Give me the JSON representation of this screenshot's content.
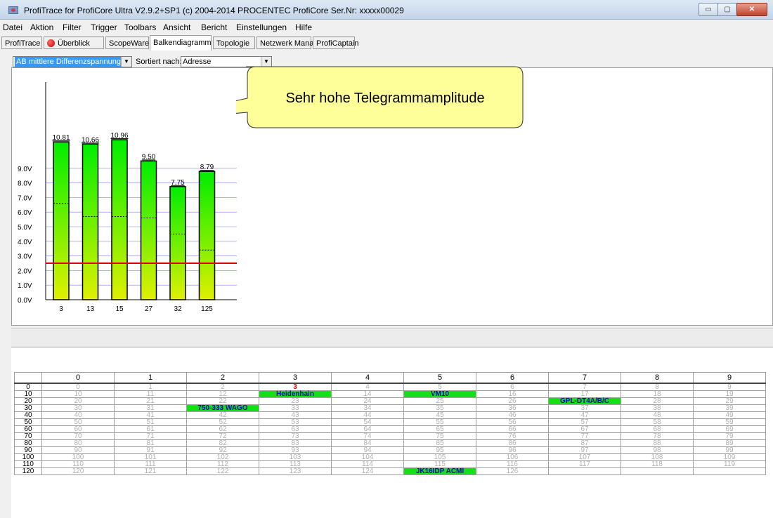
{
  "window": {
    "title": "ProfiTrace for ProfiCore Ultra V2.9.2+SP1 (c) 2004-2014 PROCENTEC  ProfiCore Ser.Nr: xxxxx00029",
    "minimize": "▭",
    "maximize": "▢",
    "close": "✕"
  },
  "menu": [
    "Datei",
    "Aktion",
    "Filter",
    "Trigger",
    "Toolbars",
    "Ansicht",
    "Bericht",
    "Einstellungen",
    "Hilfe"
  ],
  "tabs": [
    "ProfiTrace",
    "Überblick",
    "ScopeWare",
    "Balkendiagramm",
    "Topologie",
    "Netzwerk Manager",
    "ProfiCaptain"
  ],
  "toolbar": {
    "measure_value": "AB mittlere Differenzspannung",
    "sort_label": "Sortiert nach:",
    "sort_value": "Adresse"
  },
  "callout": {
    "text": "Sehr hohe Telegrammamplitude"
  },
  "chart_data": {
    "type": "bar",
    "categories": [
      "3",
      "13",
      "15",
      "27",
      "32",
      "125"
    ],
    "values": [
      10.81,
      10.66,
      10.96,
      9.5,
      7.75,
      8.79
    ],
    "value_labels": [
      "10.81",
      "10.66",
      "10.96",
      "9.50",
      "7.75",
      "8.79"
    ],
    "secondary_markers": [
      6.6,
      5.7,
      5.7,
      5.6,
      4.5,
      3.4
    ],
    "threshold": 2.5,
    "y_ticks": [
      "0.0V",
      "1.0V",
      "2.0V",
      "3.0V",
      "4.0V",
      "5.0V",
      "6.0V",
      "7.0V",
      "8.0V",
      "9.0V"
    ],
    "ylim": [
      0,
      11
    ],
    "colors": {
      "bar_top": "#00ee00",
      "bar_bottom": "#e0f000",
      "threshold": "#e00000",
      "grid": "#8080ff"
    }
  },
  "address_grid": {
    "columns": [
      "0",
      "1",
      "2",
      "3",
      "4",
      "5",
      "6",
      "7",
      "8",
      "9"
    ],
    "rows": [
      {
        "label": "0",
        "cells": [
          "0",
          "1",
          "2",
          "3",
          "4",
          "5",
          "6",
          "7",
          "8",
          "9"
        ]
      },
      {
        "label": "10",
        "cells": [
          "10",
          "11",
          "12",
          "Heidenhain",
          "14",
          "VM10",
          "16",
          "17",
          "18",
          "19"
        ]
      },
      {
        "label": "20",
        "cells": [
          "20",
          "21",
          "22",
          "23",
          "24",
          "25",
          "26",
          "GPL-DT4A/B/C",
          "28",
          "29"
        ]
      },
      {
        "label": "30",
        "cells": [
          "30",
          "31",
          "750-333 WAGO",
          "33",
          "34",
          "35",
          "36",
          "37",
          "38",
          "39"
        ]
      },
      {
        "label": "40",
        "cells": [
          "40",
          "41",
          "42",
          "43",
          "44",
          "45",
          "46",
          "47",
          "48",
          "49"
        ]
      },
      {
        "label": "50",
        "cells": [
          "50",
          "51",
          "52",
          "53",
          "54",
          "55",
          "56",
          "57",
          "58",
          "59"
        ]
      },
      {
        "label": "60",
        "cells": [
          "60",
          "61",
          "62",
          "63",
          "64",
          "65",
          "66",
          "67",
          "68",
          "69"
        ]
      },
      {
        "label": "70",
        "cells": [
          "70",
          "71",
          "72",
          "73",
          "74",
          "75",
          "76",
          "77",
          "78",
          "79"
        ]
      },
      {
        "label": "80",
        "cells": [
          "80",
          "81",
          "82",
          "83",
          "84",
          "85",
          "86",
          "87",
          "88",
          "89"
        ]
      },
      {
        "label": "90",
        "cells": [
          "90",
          "91",
          "92",
          "93",
          "94",
          "95",
          "96",
          "97",
          "98",
          "99"
        ]
      },
      {
        "label": "100",
        "cells": [
          "100",
          "101",
          "102",
          "103",
          "104",
          "105",
          "106",
          "107",
          "108",
          "109"
        ]
      },
      {
        "label": "110",
        "cells": [
          "110",
          "111",
          "112",
          "113",
          "114",
          "115",
          "116",
          "117",
          "118",
          "119"
        ]
      },
      {
        "label": "120",
        "cells": [
          "120",
          "121",
          "122",
          "123",
          "124",
          "JK16IDP ACMI",
          "126",
          "",
          "",
          ""
        ]
      }
    ],
    "highlighted": [
      "Heidenhain",
      "VM10",
      "GPL-DT4A/B/C",
      "750-333 WAGO",
      "JK16IDP ACMI"
    ],
    "red_cells": [
      "0:3"
    ]
  }
}
